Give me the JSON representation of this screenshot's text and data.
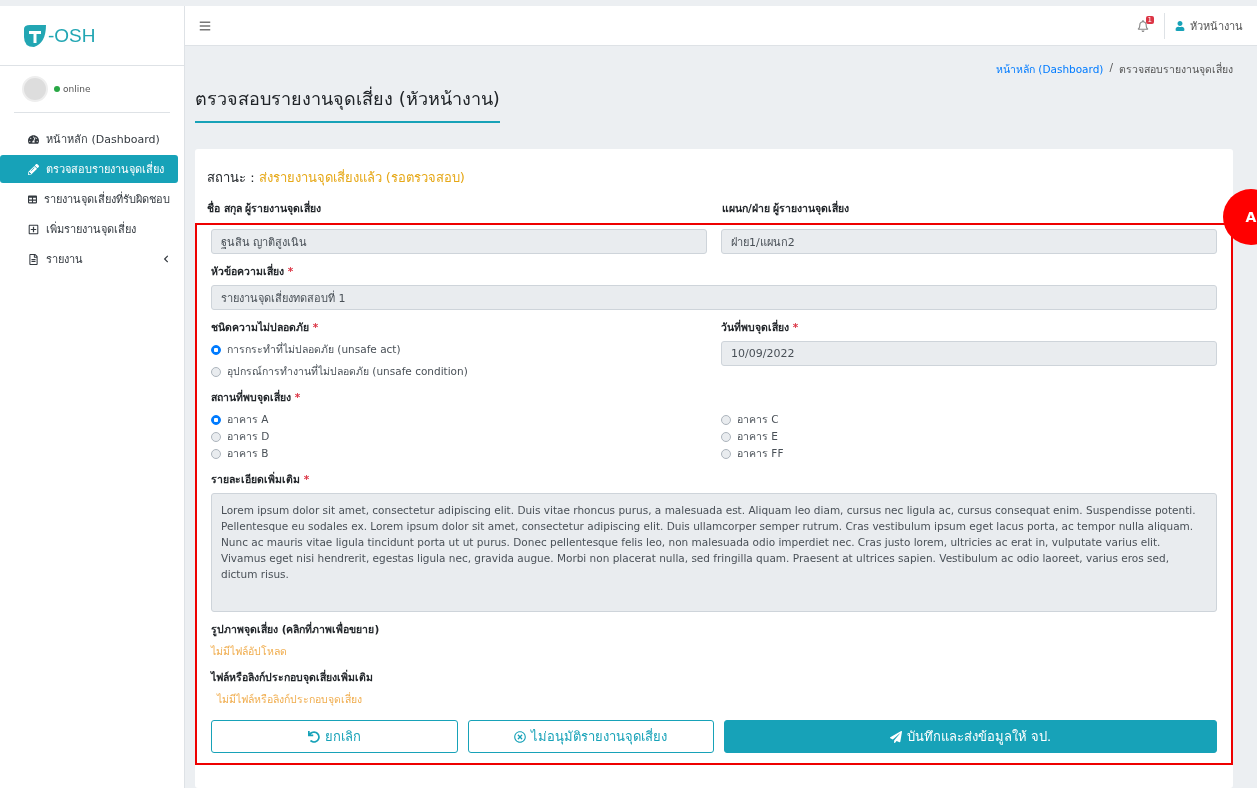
{
  "brand": {
    "logo_text": "-OSH"
  },
  "user_panel": {
    "status": "online"
  },
  "sidebar": {
    "items": [
      {
        "label": "หน้าหลัก (Dashboard)",
        "selected": false,
        "has_submenu": false
      },
      {
        "label": "ตรวจสอบรายงานจุดเสี่ยง",
        "selected": true,
        "has_submenu": false
      },
      {
        "label": "รายงานจุดเสี่ยงที่รับผิดชอบ",
        "selected": false,
        "has_submenu": false
      },
      {
        "label": "เพิ่มรายงานจุดเสี่ยง",
        "selected": false,
        "has_submenu": false
      },
      {
        "label": "รายงาน",
        "selected": false,
        "has_submenu": true
      }
    ]
  },
  "topbar": {
    "notification_count": "1",
    "user": "หัวหน้างาน"
  },
  "breadcrumb_separator": "/",
  "breadcrumb": [
    {
      "label": "หน้าหลัก (Dashboard)",
      "link": true
    },
    {
      "label": "ตรวจสอบรายงานจุดเสี่ยง",
      "link": false
    }
  ],
  "page_title": "ตรวจสอบรายงานจุดเสี่ยง (หัวหน้างาน)",
  "status": {
    "label": "สถานะ :",
    "value": "ส่งรายงานจุดเสี่ยงแล้ว (รอตรวจสอบ)"
  },
  "form": {
    "reporter_name": {
      "label": "ชื่อ สกุล ผู้รายงานจุดเสี่ยง",
      "value": "ฐนสิน ญาติสูงเนิน"
    },
    "department": {
      "label": "แผนก/ฝ่าย ผู้รายงานจุดเสี่ยง",
      "value": "ฝ่าย1/แผนก2"
    },
    "subject": {
      "label": "หัวข้อความเสี่ยง",
      "required_mark": "*",
      "value": "รายงานจุดเสี่ยงทดสอบที่ 1"
    },
    "hazard_type": {
      "label": "ชนิดความไม่ปลอดภัย",
      "required_mark": "*",
      "options": [
        {
          "label": "การกระทำที่ไม่ปลอดภัย (unsafe act)",
          "selected": true
        },
        {
          "label": "อุปกรณ์การทำงานที่ไม่ปลอดภัย (unsafe condition)",
          "selected": false
        }
      ]
    },
    "found_date": {
      "label": "วันที่พบจุดเสี่ยง",
      "required_mark": "*",
      "value": "10/09/2022"
    },
    "location": {
      "label": "สถานที่พบจุดเสี่ยง",
      "required_mark": "*",
      "options": [
        {
          "label": "อาคาร A",
          "selected": true
        },
        {
          "label": "อาคาร D",
          "selected": false
        },
        {
          "label": "อาคาร B",
          "selected": false
        },
        {
          "label": "อาคาร C",
          "selected": false
        },
        {
          "label": "อาคาร E",
          "selected": false
        },
        {
          "label": "อาคาร FF",
          "selected": false
        }
      ]
    },
    "details": {
      "label": "รายละเอียดเพิ่มเติม",
      "required_mark": "*",
      "value": "Lorem ipsum dolor sit amet, consectetur adipiscing elit. Duis vitae rhoncus purus, a malesuada est. Aliquam leo diam, cursus nec ligula ac, cursus consequat enim. Suspendisse potenti. Pellentesque eu sodales ex. Lorem ipsum dolor sit amet, consectetur adipiscing elit. Duis ullamcorper semper rutrum. Cras vestibulum ipsum eget lacus porta, ac tempor nulla aliquam. Nunc ac mauris vitae ligula tincidunt porta ut ut purus. Donec pellentesque felis leo, non malesuada odio imperdiet nec. Cras justo lorem, ultricies ac erat in, vulputate varius elit. Vivamus eget nisi hendrerit, egestas ligula nec, gravida augue. Morbi non placerat nulla, sed fringilla quam. Praesent at ultrices sapien. Vestibulum ac odio laoreet, varius eros sed, dictum risus."
    },
    "images": {
      "label": "รูปภาพจุดเสี่ยง (คลิกที่ภาพเพื่อขยาย)",
      "empty": "ไม่มีไฟล์อัปโหลด"
    },
    "attachments": {
      "label": "ไฟล์หรือลิงก์ประกอบจุดเสี่ยงเพิ่มเติม",
      "empty": "ไม่มีไฟล์หรือลิงก์ประกอบจุดเสี่ยง"
    }
  },
  "buttons": [
    {
      "label": "ยกเลิก",
      "kind": "cancel"
    },
    {
      "label": "ไม่อนุมัติรายงานจุดเสี่ยง",
      "kind": "reject"
    },
    {
      "label": "บันทึกและส่งข้อมูลให้ จป.",
      "kind": "submit"
    }
  ],
  "annotation": {
    "label": "A"
  }
}
